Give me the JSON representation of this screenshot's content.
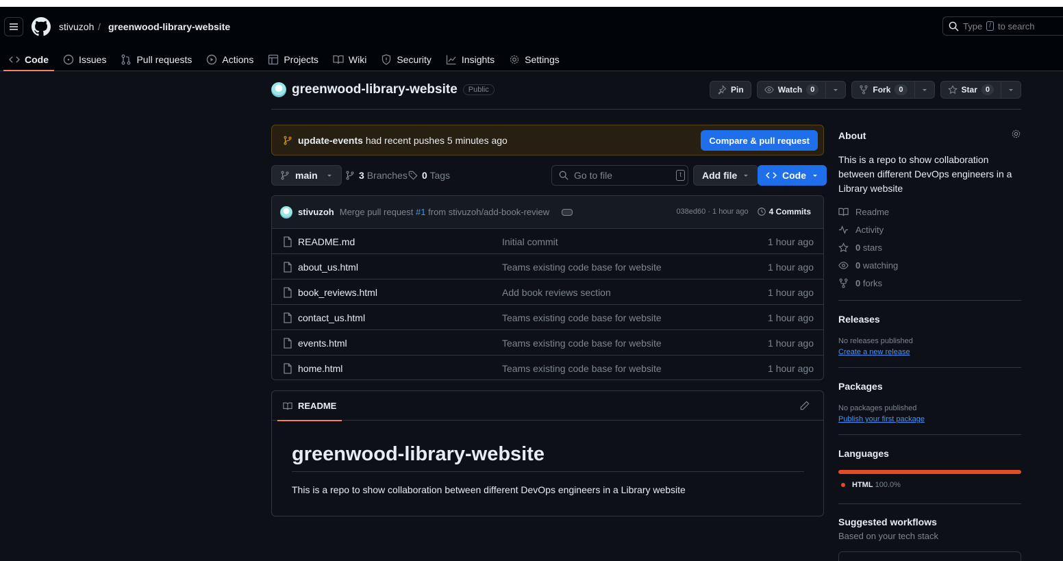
{
  "header": {
    "owner": "stivuzoh",
    "separator": "/",
    "repo": "greenwood-library-website",
    "search_placeholder_prefix": "Type",
    "search_key": "/",
    "search_placeholder_suffix": "to search"
  },
  "tabs": [
    {
      "label": "Code",
      "icon": "code-icon",
      "active": true
    },
    {
      "label": "Issues",
      "icon": "issue-icon"
    },
    {
      "label": "Pull requests",
      "icon": "pull-request-icon"
    },
    {
      "label": "Actions",
      "icon": "play-icon"
    },
    {
      "label": "Projects",
      "icon": "table-icon"
    },
    {
      "label": "Wiki",
      "icon": "book-icon"
    },
    {
      "label": "Security",
      "icon": "shield-icon"
    },
    {
      "label": "Insights",
      "icon": "graph-icon"
    },
    {
      "label": "Settings",
      "icon": "gear-icon"
    }
  ],
  "repo": {
    "name": "greenwood-library-website",
    "visibility": "Public",
    "pin_label": "Pin",
    "watch_label": "Watch",
    "watch_count": "0",
    "fork_label": "Fork",
    "fork_count": "0",
    "star_label": "Star",
    "star_count": "0"
  },
  "banner": {
    "branch": "update-events",
    "text": "had recent pushes 5 minutes ago",
    "button": "Compare & pull request"
  },
  "toolbar": {
    "branch": "main",
    "branches_count": "3",
    "branches_label": "Branches",
    "tags_count": "0",
    "tags_label": "Tags",
    "goto_placeholder": "Go to file",
    "goto_key": "t",
    "add_file": "Add file",
    "code": "Code"
  },
  "commit": {
    "author": "stivuzoh",
    "msg_prefix": "Merge pull request",
    "pr": "#1",
    "msg_suffix": "from stivuzoh/add-book-review",
    "hash_time": "038ed60 · 1 hour ago",
    "commits": "4 Commits"
  },
  "files": [
    {
      "name": "README.md",
      "message": "Initial commit",
      "time": "1 hour ago"
    },
    {
      "name": "about_us.html",
      "message": "Teams existing code base for website",
      "time": "1 hour ago"
    },
    {
      "name": "book_reviews.html",
      "message": "Add book reviews section",
      "time": "1 hour ago"
    },
    {
      "name": "contact_us.html",
      "message": "Teams existing code base for website",
      "time": "1 hour ago"
    },
    {
      "name": "events.html",
      "message": "Teams existing code base for website",
      "time": "1 hour ago"
    },
    {
      "name": "home.html",
      "message": "Teams existing code base for website",
      "time": "1 hour ago"
    }
  ],
  "readme": {
    "tab": "README",
    "title": "greenwood-library-website",
    "body": "This is a repo to show collaboration between different DevOps engineers in a Library website"
  },
  "sidebar": {
    "about_title": "About",
    "about_desc": "This is a repo to show collaboration between different DevOps engineers in a Library website",
    "links": [
      {
        "icon": "book-icon",
        "count": "",
        "label": "Readme"
      },
      {
        "icon": "pulse-icon",
        "count": "",
        "label": "Activity"
      },
      {
        "icon": "star-icon",
        "count": "0",
        "label": "stars"
      },
      {
        "icon": "eye-icon",
        "count": "0",
        "label": "watching"
      },
      {
        "icon": "fork-icon",
        "count": "0",
        "label": "forks"
      }
    ],
    "releases_title": "Releases",
    "releases_none": "No releases published",
    "releases_link": "Create a new release",
    "packages_title": "Packages",
    "packages_none": "No packages published",
    "packages_link": "Publish your first package",
    "languages_title": "Languages",
    "language": {
      "name": "HTML",
      "percent": "100.0%",
      "share": 1.0,
      "color": "#e34c26"
    },
    "workflows_title": "Suggested workflows",
    "workflows_sub": "Based on your tech stack"
  },
  "colors": {
    "accent": "#1f6feb",
    "tab_underline": "#f78166",
    "background": "#0d1117"
  }
}
